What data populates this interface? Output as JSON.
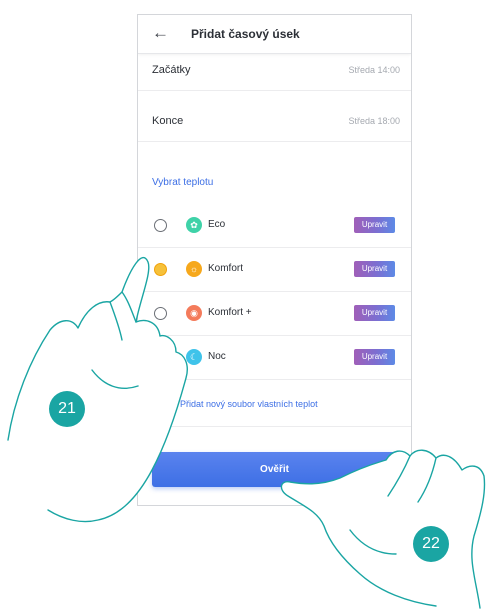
{
  "header": {
    "back_icon": "arrow-left-icon",
    "title": "Přidat časový úsek"
  },
  "rows": [
    {
      "label": "Začátky",
      "value": "Středa 14:00"
    },
    {
      "label": "Konce",
      "value": "Středa 18:00"
    }
  ],
  "section_title": "Vybrat teplotu",
  "options": [
    {
      "label": "Eco",
      "icon": "leaf-icon",
      "color": "#3fd2a8",
      "button": "Upravit",
      "selected": false
    },
    {
      "label": "Komfort",
      "icon": "sun-icon",
      "color": "#f6a81c",
      "button": "Upravit",
      "selected": true
    },
    {
      "label": "Komfort +",
      "icon": "flame-icon",
      "color": "#f47b5b",
      "button": "Upravit",
      "selected": false
    },
    {
      "label": "Noc",
      "icon": "moon-icon",
      "color": "#3fc3ea",
      "button": "Upravit",
      "selected": false
    }
  ],
  "add_set": {
    "icon": "plus-icon",
    "label": "Přidat nový soubor vlastních teplot"
  },
  "verify_label": "Ověřit",
  "badges": [
    "21",
    "22"
  ],
  "colors": {
    "accent": "#3d6fe5",
    "badge": "#1aa5a3"
  }
}
